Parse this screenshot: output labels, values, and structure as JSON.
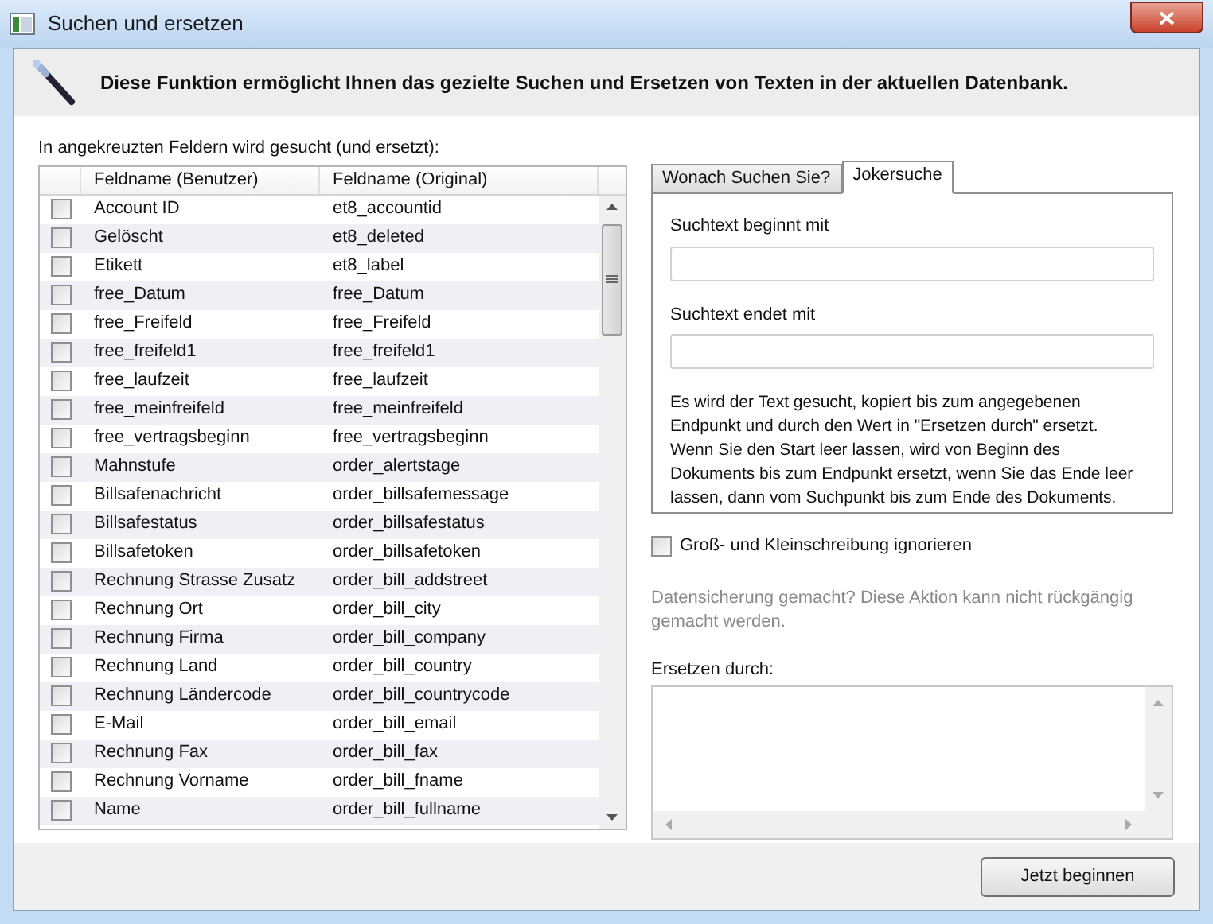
{
  "window": {
    "title": "Suchen und ersetzen"
  },
  "header": {
    "text": "Diese Funktion ermöglicht Ihnen das gezielte Suchen und Ersetzen von Texten in der aktuellen Datenbank."
  },
  "fields_label": "In angekreuzten Feldern wird gesucht (und ersetzt):",
  "table": {
    "columns": [
      "Feldname (Benutzer)",
      "Feldname (Original)"
    ],
    "rows": [
      {
        "user": "Account ID",
        "original": "et8_accountid",
        "checked": false
      },
      {
        "user": "Gelöscht",
        "original": "et8_deleted",
        "checked": false
      },
      {
        "user": "Etikett",
        "original": "et8_label",
        "checked": false
      },
      {
        "user": "free_Datum",
        "original": "free_Datum",
        "checked": false
      },
      {
        "user": "free_Freifeld",
        "original": "free_Freifeld",
        "checked": false
      },
      {
        "user": "free_freifeld1",
        "original": "free_freifeld1",
        "checked": false
      },
      {
        "user": "free_laufzeit",
        "original": "free_laufzeit",
        "checked": false
      },
      {
        "user": "free_meinfreifeld",
        "original": "free_meinfreifeld",
        "checked": false
      },
      {
        "user": "free_vertragsbeginn",
        "original": "free_vertragsbeginn",
        "checked": false
      },
      {
        "user": "Mahnstufe",
        "original": "order_alertstage",
        "checked": false
      },
      {
        "user": "Billsafenachricht",
        "original": "order_billsafemessage",
        "checked": false
      },
      {
        "user": "Billsafestatus",
        "original": "order_billsafestatus",
        "checked": false
      },
      {
        "user": "Billsafetoken",
        "original": "order_billsafetoken",
        "checked": false
      },
      {
        "user": "Rechnung Strasse Zusatz",
        "original": "order_bill_addstreet",
        "checked": false
      },
      {
        "user": "Rechnung Ort",
        "original": "order_bill_city",
        "checked": false
      },
      {
        "user": "Rechnung Firma",
        "original": "order_bill_company",
        "checked": false
      },
      {
        "user": "Rechnung Land",
        "original": "order_bill_country",
        "checked": false
      },
      {
        "user": "Rechnung Ländercode",
        "original": "order_bill_countrycode",
        "checked": false
      },
      {
        "user": "E-Mail",
        "original": "order_bill_email",
        "checked": false
      },
      {
        "user": "Rechnung Fax",
        "original": "order_bill_fax",
        "checked": false
      },
      {
        "user": "Rechnung Vorname",
        "original": "order_bill_fname",
        "checked": false
      },
      {
        "user": "Name",
        "original": "order_bill_fullname",
        "checked": false
      }
    ]
  },
  "tabs": [
    {
      "label": "Wonach Suchen Sie?",
      "selected": false
    },
    {
      "label": "Jokersuche",
      "selected": true
    }
  ],
  "joker": {
    "start_label": "Suchtext beginnt mit",
    "end_label": "Suchtext endet mit",
    "description": "Es wird der Text gesucht, kopiert bis zum angegebenen Endpunkt und durch den Wert in \"Ersetzen durch\" ersetzt. Wenn Sie den Start leer lassen, wird von Beginn des Dokuments bis zum Endpunkt ersetzt, wenn Sie das Ende leer lassen, dann vom Suchpunkt bis zum Ende des Dokuments."
  },
  "ignore_case": {
    "label": "Groß- und Kleinschreibung ignorieren",
    "checked": false
  },
  "warning": "Datensicherung gemacht? Diese Aktion kann nicht rückgängig gemacht werden.",
  "replace_label": "Ersetzen durch:",
  "start_button": "Jetzt beginnen"
}
